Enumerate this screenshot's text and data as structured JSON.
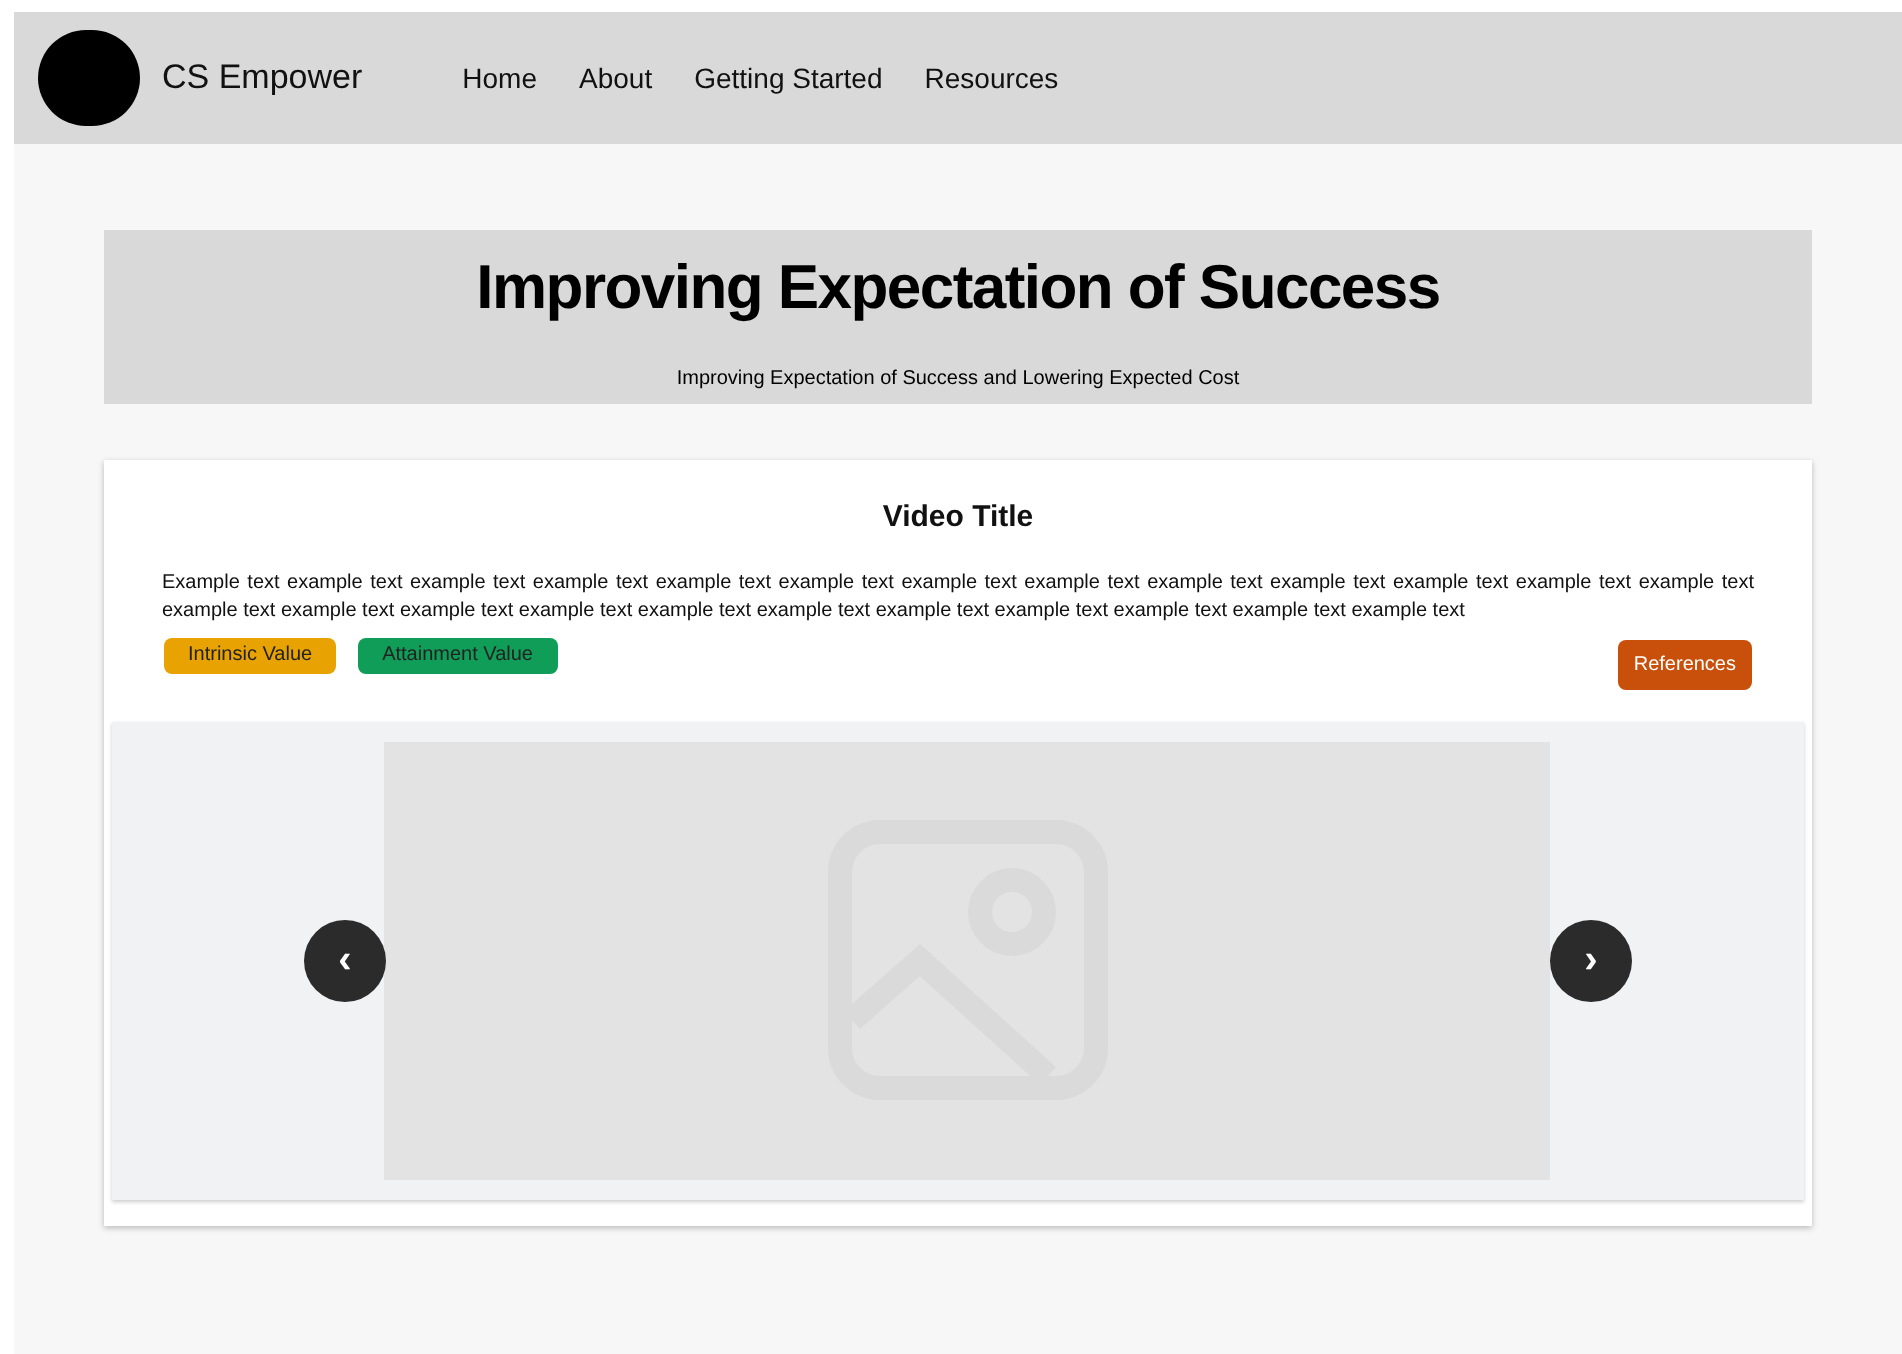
{
  "nav": {
    "brand": "CS Empower",
    "links": [
      "Home",
      "About",
      "Getting Started",
      "Resources"
    ]
  },
  "hero": {
    "title": "Improving Expectation of Success",
    "subtitle": "Improving Expectation of Success and Lowering Expected Cost"
  },
  "card": {
    "title": "Video Title",
    "body": "Example text example text example text example text example text example text example text example text example text example text example text example text example text example text example text example text example text example text example text example text example text example text example text example text",
    "tags": [
      {
        "label": "Intrinsic Value",
        "color": "#e8a202"
      },
      {
        "label": "Attainment Value",
        "color": "#0f9d58"
      }
    ],
    "references": "References"
  },
  "carousel": {
    "prev": "‹",
    "next": "›"
  }
}
